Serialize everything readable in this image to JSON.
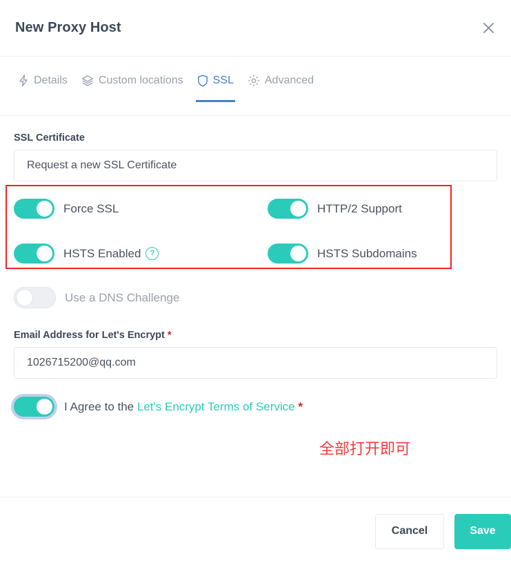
{
  "header": {
    "title": "New Proxy Host",
    "close_icon": "close-icon"
  },
  "tabs": [
    {
      "label": "Details",
      "icon": "lightning-bolt-icon",
      "active": false
    },
    {
      "label": "Custom locations",
      "icon": "layers-icon",
      "active": false
    },
    {
      "label": "SSL",
      "icon": "shield-icon",
      "active": true
    },
    {
      "label": "Advanced",
      "icon": "gear-icon",
      "active": false
    }
  ],
  "ssl_certificate": {
    "label": "SSL Certificate",
    "selected": "Request a new SSL Certificate"
  },
  "toggles": {
    "force_ssl": {
      "label": "Force SSL",
      "on": true
    },
    "http2_support": {
      "label": "HTTP/2 Support",
      "on": true
    },
    "hsts_enabled": {
      "label": "HSTS Enabled",
      "on": true,
      "help_icon": "question-circle-icon"
    },
    "hsts_subdomains": {
      "label": "HSTS Subdomains",
      "on": true
    },
    "dns_challenge": {
      "label": "Use a DNS Challenge",
      "on": false
    }
  },
  "annotation": {
    "text": "全部打开即可",
    "box_color": "#f42424",
    "text_color": "#f73b3b"
  },
  "email": {
    "label": "Email Address for Let's Encrypt",
    "required_marker": "*",
    "value": "1026715200@qq.com"
  },
  "agree": {
    "prefix": "I Agree to the",
    "link": "Let's Encrypt Terms of Service",
    "required_marker": "*",
    "on": true
  },
  "footer": {
    "cancel_label": "Cancel",
    "save_label": "Save"
  },
  "colors": {
    "accent_teal": "#2bcbba",
    "active_tab_blue": "#467fcf",
    "required_red": "#cd201f"
  }
}
